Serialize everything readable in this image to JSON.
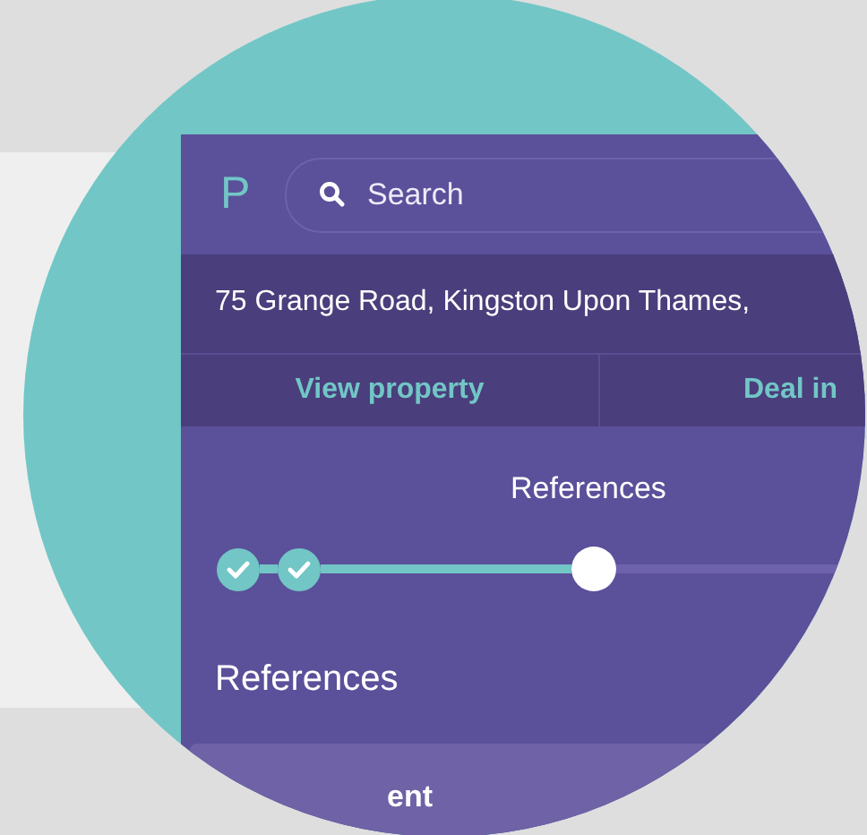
{
  "app_bar": {
    "logo": "P",
    "search": {
      "placeholder": "Search"
    }
  },
  "address": "75 Grange Road, Kingston Upon Thames,",
  "tabs": [
    {
      "label": "View property",
      "selected": false
    },
    {
      "label": "Deal in",
      "selected": false
    }
  ],
  "stepper": {
    "current_label": "References",
    "steps": [
      {
        "kind": "done"
      },
      {
        "kind": "done"
      },
      {
        "kind": "current"
      }
    ]
  },
  "section_title": "References",
  "card": {
    "text": "ent"
  }
}
